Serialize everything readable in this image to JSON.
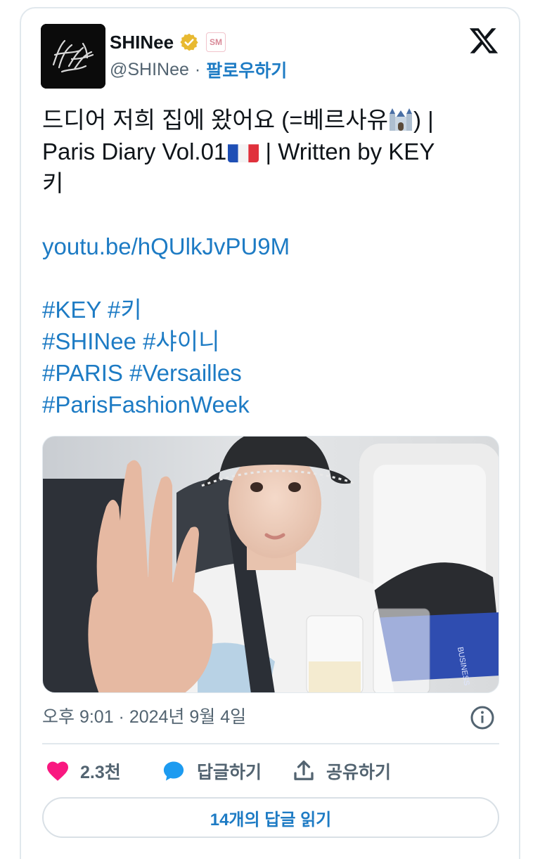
{
  "account": {
    "name": "SHINee",
    "handle": "@SHINee",
    "separator": "·",
    "follow_label": "팔로우하기",
    "affiliate_badge": "SM",
    "icons": [
      "verified-gold-check-icon",
      "x-logo-icon"
    ]
  },
  "tweet": {
    "lines": [
      "드디어 저희 집에 왔어요 (=베르사유",
      ") |",
      "Paris Diary Vol.01",
      " | Written by KEY",
      "키"
    ],
    "link": "youtu.be/hQUlkJvPU9M",
    "hashtag_lines": [
      "#KEY #키",
      "#SHINee #샤이니",
      "#PARIS #Versailles",
      "#ParisFashionWeek"
    ]
  },
  "meta": {
    "timestamp": "오후 9:01 · 2024년 9월 4일"
  },
  "actions": {
    "like_count": "2.3천",
    "reply_label": "답글하기",
    "share_label": "공유하기"
  },
  "read_replies_label": "14개의 답글 읽기",
  "colors": {
    "link_blue": "#1d7bc4",
    "like_pink": "#f91880",
    "reply_blue": "#1d9bf0",
    "verified_gold": "#e8b931",
    "border": "#e1e8ed"
  }
}
